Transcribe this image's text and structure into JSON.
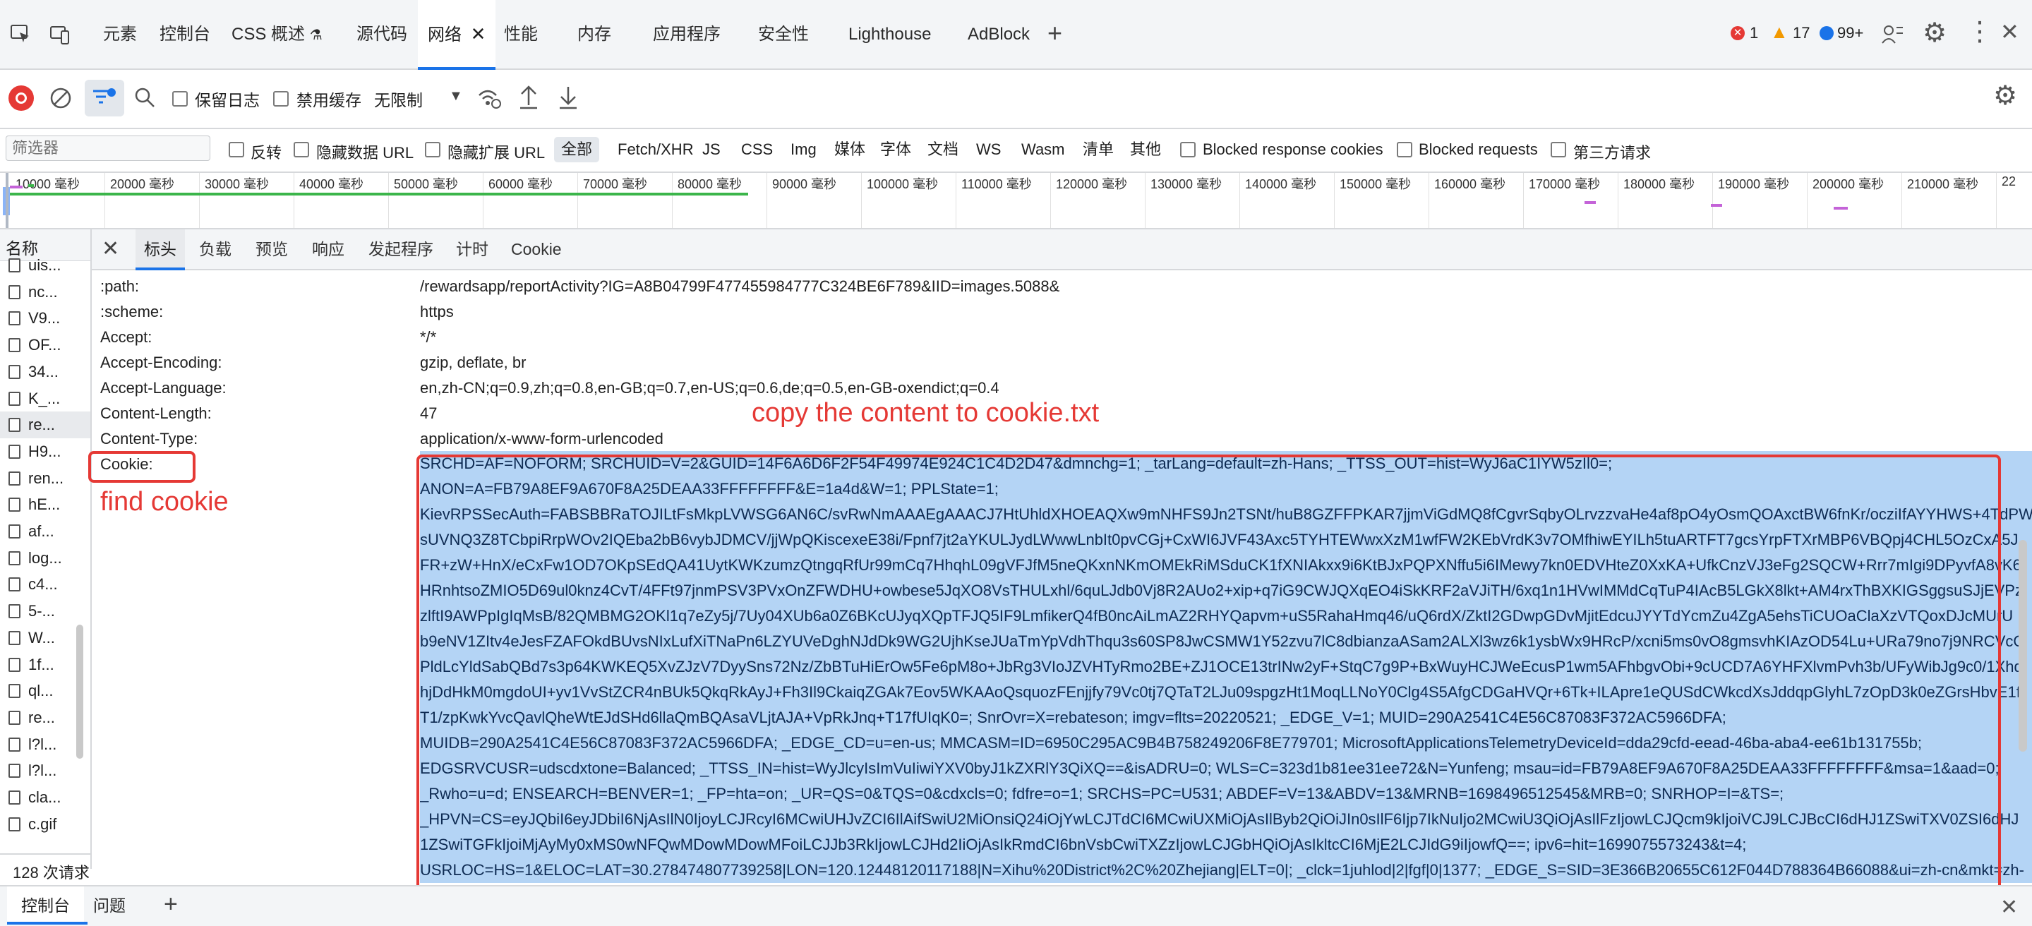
{
  "tabs": {
    "items": [
      "元素",
      "控制台",
      "CSS 概述",
      "源代码",
      "网络",
      "性能",
      "内存",
      "应用程序",
      "安全性",
      "Lighthouse",
      "AdBlock"
    ],
    "errors": "1",
    "warnings": "17",
    "messages": "99+"
  },
  "toolbar": {
    "preserve_log": "保留日志",
    "disable_cache": "禁用缓存",
    "throttle": "无限制"
  },
  "filter": {
    "placeholder": "筛选器",
    "invert": "反转",
    "hide_data_urls": "隐藏数据 URL",
    "hide_ext_urls": "隐藏扩展 URL",
    "types": [
      "全部",
      "Fetch/XHR",
      "JS",
      "CSS",
      "Img",
      "媒体",
      "字体",
      "文档",
      "WS",
      "Wasm",
      "清单",
      "其他"
    ],
    "blocked_cookies": "Blocked response cookies",
    "blocked_requests": "Blocked requests",
    "third_party": "第三方请求"
  },
  "timeline": {
    "ticks": [
      "10000 毫秒",
      "20000 毫秒",
      "30000 毫秒",
      "40000 毫秒",
      "50000 毫秒",
      "60000 毫秒",
      "70000 毫秒",
      "80000 毫秒",
      "90000 毫秒",
      "100000 毫秒",
      "110000 毫秒",
      "120000 毫秒",
      "130000 毫秒",
      "140000 毫秒",
      "150000 毫秒",
      "160000 毫秒",
      "170000 毫秒",
      "180000 毫秒",
      "190000 毫秒",
      "200000 毫秒",
      "210000 毫秒",
      "22"
    ]
  },
  "names": {
    "header": "名称",
    "rows": [
      "uis...",
      "nc...",
      "V9...",
      "OF...",
      "34...",
      "K_...",
      "re...",
      "H9...",
      "ren...",
      "hE...",
      "af...",
      "log...",
      "c4...",
      "5-...",
      "W...",
      "1f...",
      "ql...",
      "re...",
      "l?l...",
      "l?l...",
      "cla...",
      "c.gif"
    ],
    "status": "128 次请求"
  },
  "detail": {
    "tabs": [
      "标头",
      "负载",
      "预览",
      "响应",
      "发起程序",
      "计时",
      "Cookie"
    ],
    "headers": [
      {
        "name": ":path:",
        "value": "/rewardsapp/reportActivity?IG=A8B04799F477455984777C324BE6F789&IID=images.5088&"
      },
      {
        "name": ":scheme:",
        "value": "https"
      },
      {
        "name": "Accept:",
        "value": "*/*"
      },
      {
        "name": "Accept-Encoding:",
        "value": "gzip, deflate, br"
      },
      {
        "name": "Accept-Language:",
        "value": "en,zh-CN;q=0.9,zh;q=0.8,en-GB;q=0.7,en-US;q=0.6,de;q=0.5,en-GB-oxendict;q=0.4"
      },
      {
        "name": "Content-Length:",
        "value": "47"
      },
      {
        "name": "Content-Type:",
        "value": "application/x-www-form-urlencoded"
      }
    ],
    "cookie_name": "Cookie:",
    "cookie_lines": [
      "SRCHD=AF=NOFORM; SRCHUID=V=2&GUID=14F6A6D6F2F54F49974E924C1C4D2D47&dmnchg=1; _tarLang=default=zh-Hans; _TTSS_OUT=hist=WyJ6aC1IYW5zIl0=;",
      "ANON=A=FB79A8EF9A670F8A25DEAA33FFFFFFFF&E=1a4d&W=1; PPLState=1;",
      "KievRPSSecAuth=FABSBBRaTOJILtFsMkpLVWSG6AN6C/svRwNmAAAEgAAACJ7HtUhldXHOEAQXw9mNHFS9Jn2TSNt/huB8GZFFPKAR7jjmViGdMQ8fCgvrSqbyOLrvzzvaHe4af8pO4yOsmQOAxctBW6fnKr/ocziIfAYYHWS+4TdPW",
      "sUVNQ3Z8TCbpiRrpWOv2IQEba2bB6vybJDMCV/jjWpQKiscexeE38i/Fpnf7jt2aYKULJydLWwwLnbIt0pvCGj+CxWI6JVF43Axc5TYHTEWwxXzM1wfFW2KEbVrdK3v7OMfhiwEYILh5tuARTFT7gcsYrpFTXrMBP6VBQpj4CHL5OzCxA5J",
      "FR+zW+HnX/eCxFw1OD7OKpSEdQA41UytKWKzumzQtngqRfUr99mCq7HhqhL09gVFJfM5neQKxnNKmOMEkRiMSduCK1fXNIAkxx9i6KtBJxPQPXNffu5i6IMewy7kn0EDVHteZ0XxKA+UfkCnzVJ3eFg2SQCW+Rrr7mIgi9DPyvfA8vK6",
      "HRnhtsoZMIO5D69ul0knz4CvT/4FFt97jnmPSV3PVxOnZFWDHU+owbese5JqXO8VsTHULxhl/6quLJdb0Vj8R2AUo2+xip+q7iG9CWJQXqEO4iSkKRF2aVJiTH/6xq1n1HVwIMMdCqTuP4IAcB5LGkX8lkt+AM4rxThBXKIGSggsuSJjEVPzl",
      "zlftI9AWPpIgIqMsB/82QMBMG2OKl1q7eZy5j/7Uy04XUb6a0Z6BKcUJyqXQpTFJQ5IF9LmfikerQ4fB0ncAiLmAZ2RHYQapvm+uS5RahaHmq46/uQ6rdX/ZktI2GDwpGDvMjitEdcuJYYTdYcmZu4ZgA5ehsTiCUOaClaXzVTQoxDJcMUrU",
      "b9eNV1ZItv4eJesFZAFOkdBUvsNIxLufXiTNaPn6LZYUVeDghNJdDk9WG2UjhKseJUaTmYpVdhThqu3s60SP8JwCSMW1Y52zvu7lC8dbianzaASam2ALXl3wz6k1ysbWx9HRcP/xcni5ms0vO8gmsvhKIAzOD54Lu+URa79no7j9NRCVcQ",
      "PldLcYldSabQBd7s3p64KWKEQ5XvZJzV7DyySns72Nz/ZbBTuHiErOw5Fe6pM8o+JbRg3VIoJZVHTyRmo2BE+ZJ1OCE13trINw2yF+StqC7g9P+BxWuyHCJWeEcusP1wm5AFhbgvObi+9cUCD7A6YHFXlvmPvh3b/UFyWibJg9c0/1Xhq",
      "hjDdHkM0mgdoUI+yv1VvStZCR4nBUk5QkqRkAyJ+Fh3Il9CkaiqZGAk7Eov5WKAAoQsquozFEnjjfy79Vc0tj7QTaT2LJu09spgzHt1MoqLLNoY0Clg4S5AfgCDGaHVQr+6Tk+ILApre1eQUSdCWkcdXsJddqpGlyhL7zOpD3k0eZGrsHbvE1f",
      "T1/zpKwkYvcQavlQheWtEJdSHd6llaQmBQAsaVLjtAJA+VpRkJnq+T17fUIqK0=; SnrOvr=X=rebateson; imgv=flts=20220521; _EDGE_V=1; MUID=290A2541C4E56C87083F372AC5966DFA;",
      "MUIDB=290A2541C4E56C87083F372AC5966DFA; _EDGE_CD=u=en-us; MMCASM=ID=6950C295AC9B4B758249206F8E779701; MicrosoftApplicationsTelemetryDeviceId=dda29cfd-eead-46ba-aba4-ee61b131755b;",
      "EDGSRVCUSR=udscdxtone=Balanced; _TTSS_IN=hist=WyJlcyIsImVuIiwiYXV0byJ1kZXRlY3QiXQ==&isADRU=0; WLS=C=323d1b81ee31ee72&N=Yunfeng; msau=id=FB79A8EF9A670F8A25DEAA33FFFFFFFF&msa=1&aad=0;",
      "_Rwho=u=d; ENSEARCH=BENVER=1; _FP=hta=on; _UR=QS=0&TQS=0&cdxcls=0; fdfre=o=1; SRCHS=PC=U531; ABDEF=V=13&ABDV=13&MRNB=1698496512545&MRB=0; SNRHOP=I=&TS=;",
      "_HPVN=CS=eyJQbiI6eyJDbiI6NjAsIlN0IjoyLCJRcyI6MCwiUHJvZCI6IlAifSwiU2MiOnsiQ24iOjYwLCJTdCI6MCwiUXMiOjAsIlByb2QiOiJIn0sIlF6Ijp7IkNuIjo2MCwiU3QiOjAsIlFzIjowLCJQcm9kIjoiVCJ9LCJBcCI6dHJ1ZSwiTXV0ZSI6dHJ",
      "1ZSwiTGFkIjoiMjAyMy0xMS0wNFQwMDowMDowMFoiLCJJb3RkIjowLCJHd2IiOjAsIkRmdCI6bnVsbCwiTXZzIjowLCJGbHQiOjAsIkltcCI6MjE2LCJIdG9iIjowfQ==; ipv6=hit=1699075573243&t=4;",
      "USRLOC=HS=1&ELOC=LAT=30.278474807739258|LON=120.12448120117188|N=Xihu%20District%2C%20Zhejiang|ELT=0|; _clck=1juhlod|2|fgf|0|1377; _EDGE_S=SID=3E366B20655C612F044D788364B66088&ui=zh-cn&mkt=zh-"
    ]
  },
  "annotations": {
    "find": "find cookie",
    "copy": "copy the content to cookie.txt"
  },
  "drawer": {
    "tabs": [
      "控制台",
      "问题"
    ]
  },
  "colors": {
    "accent": "#1a73e8",
    "annotation": "#e53935",
    "selection": "#b4d4f5"
  }
}
